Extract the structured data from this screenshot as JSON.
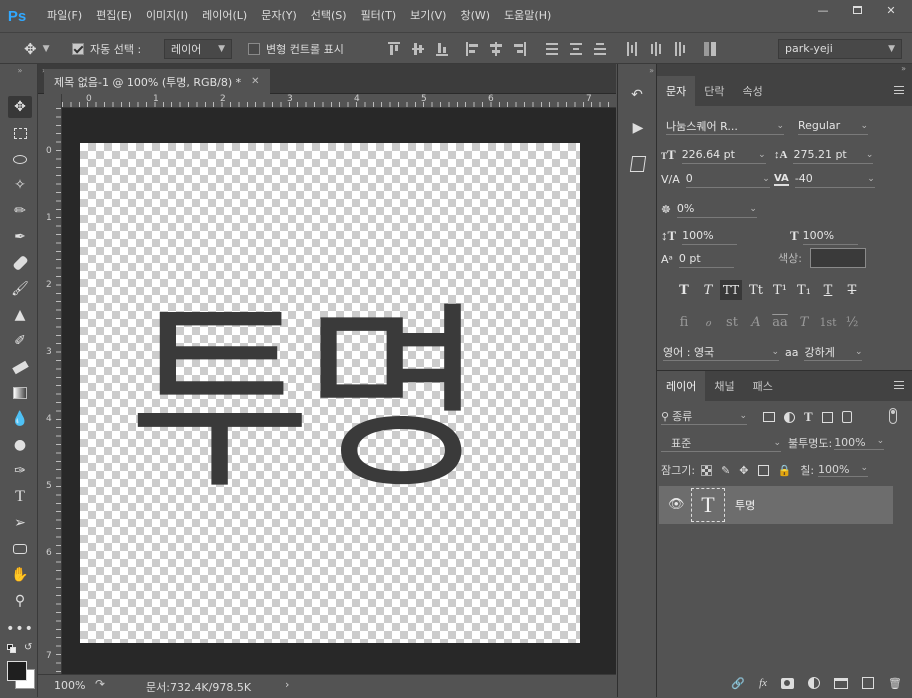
{
  "app": {
    "logo": "Ps",
    "accent": "#31a8ff"
  },
  "menu": [
    "파일(F)",
    "편집(E)",
    "이미지(I)",
    "레이어(L)",
    "문자(Y)",
    "선택(S)",
    "필터(T)",
    "보기(V)",
    "창(W)",
    "도움말(H)"
  ],
  "window_controls": [
    "minimize",
    "restore",
    "close"
  ],
  "options": {
    "auto_select_checked": true,
    "auto_select_label": "자동 선택 :",
    "auto_select_target": "레이어",
    "transform_controls_checked": false,
    "transform_controls_label": "변형 컨트롤 표시",
    "workspace": "park-yeji"
  },
  "document": {
    "tab_title": "제목 없음-1 @ 100% (투명, RGB/8) *",
    "canvas_text": "투명",
    "zoom": "100%",
    "doc_size": "문서:732.4K/978.5K",
    "ruler_top": [
      "0",
      "1",
      "2",
      "3",
      "4",
      "5",
      "6",
      "7"
    ],
    "ruler_left": [
      "0",
      "1",
      "2",
      "3",
      "4",
      "5",
      "6",
      "7"
    ]
  },
  "character": {
    "tabs": [
      "문자",
      "단락",
      "속성"
    ],
    "font_family": "나눔스퀘어 R...",
    "font_style": "Regular",
    "size": "226.64 pt",
    "leading": "275.21 pt",
    "kerning": "0",
    "tracking": "-40",
    "tsume": "0%",
    "vertical_scale": "100%",
    "horizontal_scale": "100%",
    "baseline_shift": "0 pt",
    "color_label": "색상:",
    "language": "영어 : 영국",
    "antialias_icon": "aa",
    "antialias": "강하게",
    "style_buttons": [
      "T",
      "T",
      "TT",
      "Tt",
      "T¹",
      "T₁",
      "T",
      "T"
    ],
    "opentype_buttons": [
      "fi",
      "ℴ",
      "st",
      "A",
      "aa",
      "T",
      "1st",
      "½"
    ]
  },
  "layers": {
    "tabs": [
      "레이어",
      "채널",
      "패스"
    ],
    "filter_kind": "종류",
    "blend_mode": "표준",
    "opacity_label": "불투명도:",
    "opacity": "100%",
    "lock_label": "잠그기:",
    "fill_label": "칠:",
    "fill": "100%",
    "items": [
      {
        "name": "투명",
        "type_icon": "T",
        "visible": true
      }
    ]
  }
}
